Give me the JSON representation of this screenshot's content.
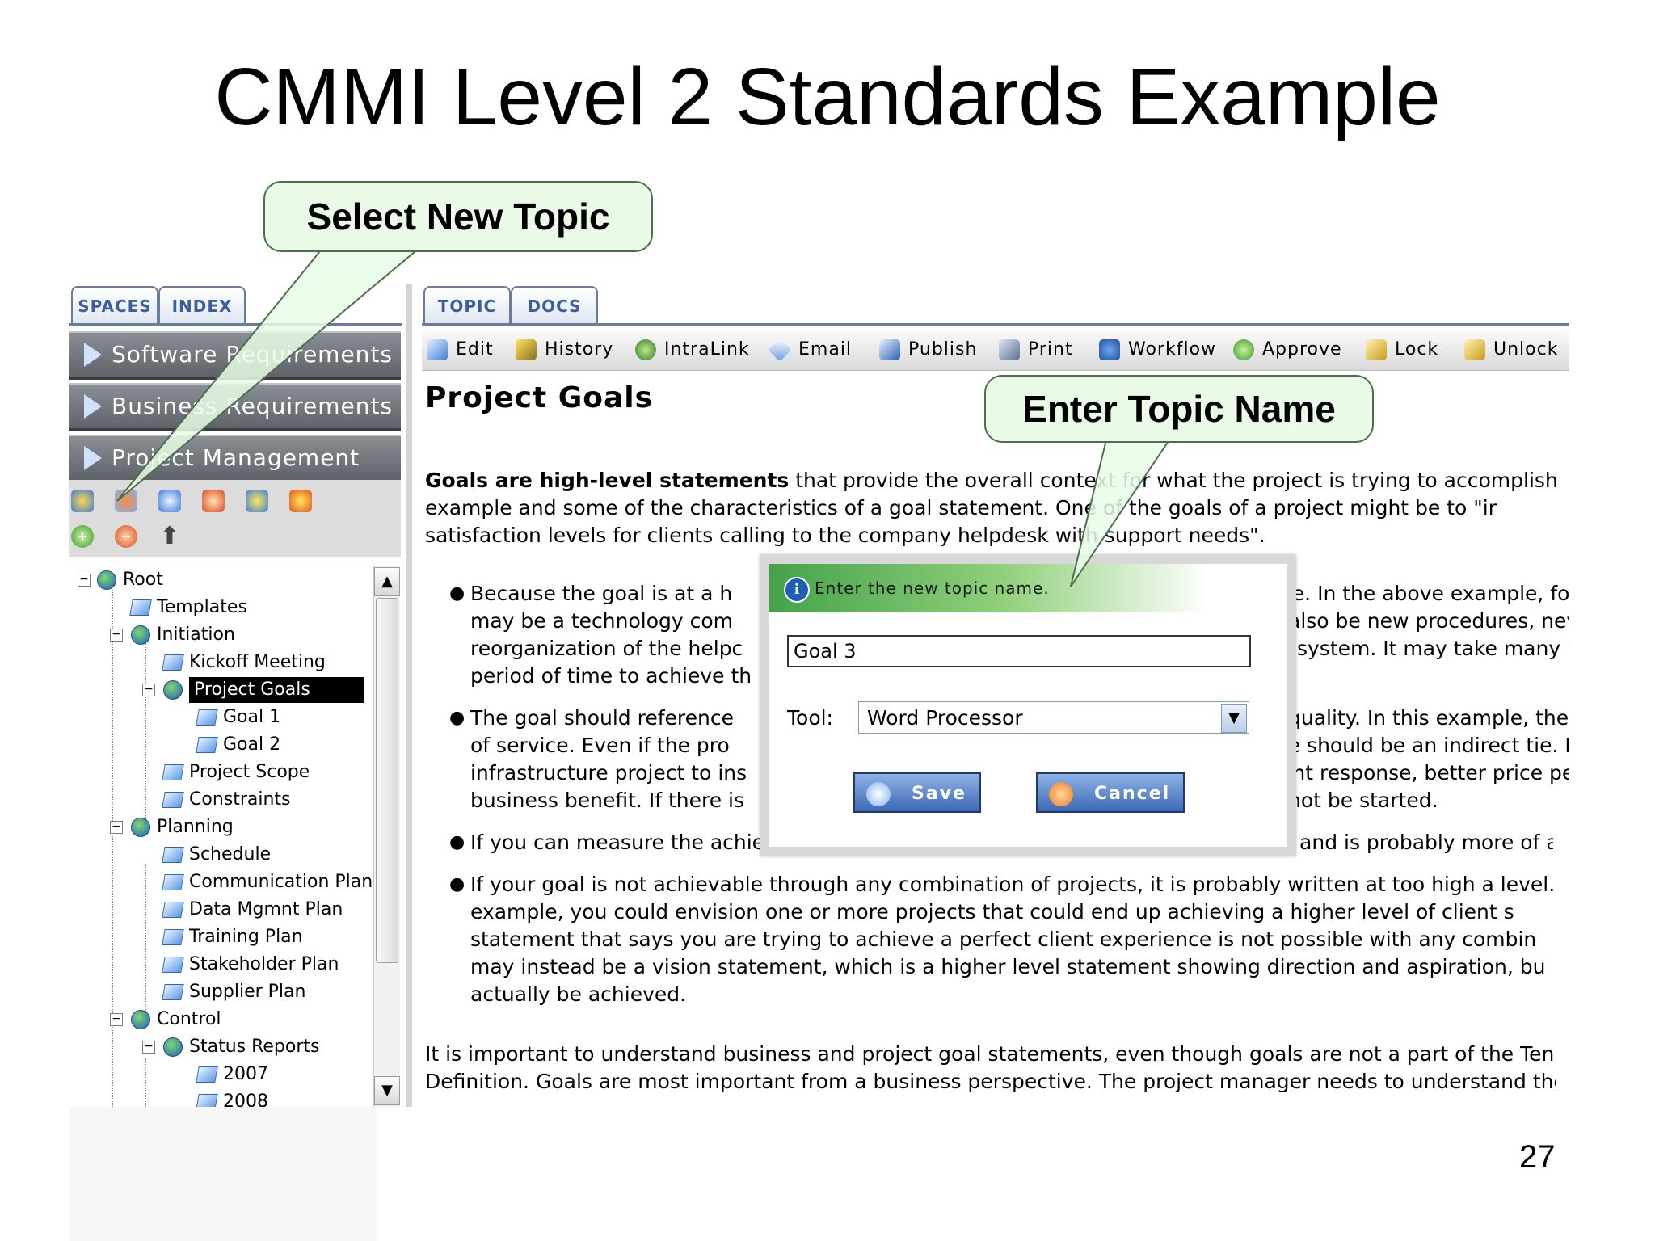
{
  "slide": {
    "title": "CMMI Level 2 Standards Example",
    "page_number": "27"
  },
  "callouts": {
    "select_topic": "Select New Topic",
    "enter_name": "Enter Topic Name"
  },
  "left_panel": {
    "tabs": [
      "SPACES",
      "INDEX"
    ],
    "spaces": [
      "Software Requirements",
      "Business Requirements",
      "Project Management"
    ],
    "tree": [
      {
        "label": "Root",
        "icon": "globe-icon",
        "expanded": true
      },
      {
        "label": "Templates",
        "icon": "gem-icon"
      },
      {
        "label": "Initiation",
        "icon": "globe-icon",
        "expanded": true
      },
      {
        "label": "Kickoff Meeting",
        "icon": "gem-icon"
      },
      {
        "label": "Project Goals",
        "icon": "globe-icon",
        "expanded": true,
        "selected": true
      },
      {
        "label": "Goal 1",
        "icon": "gem-icon"
      },
      {
        "label": "Goal 2",
        "icon": "gem-icon"
      },
      {
        "label": "Project Scope",
        "icon": "gem-icon"
      },
      {
        "label": "Constraints",
        "icon": "gem-icon"
      },
      {
        "label": "Planning",
        "icon": "globe-icon",
        "expanded": true
      },
      {
        "label": "Schedule",
        "icon": "gem-icon"
      },
      {
        "label": "Communication Plan",
        "icon": "gem-icon"
      },
      {
        "label": "Data Mgmnt Plan",
        "icon": "gem-icon"
      },
      {
        "label": "Training Plan",
        "icon": "gem-icon"
      },
      {
        "label": "Stakeholder Plan",
        "icon": "gem-icon"
      },
      {
        "label": "Supplier Plan",
        "icon": "gem-icon"
      },
      {
        "label": "Control",
        "icon": "globe-icon",
        "expanded": true
      },
      {
        "label": "Status Reports",
        "icon": "globe-icon",
        "expanded": true
      },
      {
        "label": "2007",
        "icon": "gem-icon"
      },
      {
        "label": "2008",
        "icon": "gem-icon"
      }
    ]
  },
  "right_panel": {
    "tabs": [
      "TOPIC",
      "DOCS"
    ],
    "toolbar": [
      "Edit",
      "History",
      "IntraLink",
      "Email",
      "Publish",
      "Print",
      "Workflow",
      "Approve",
      "Lock",
      "Unlock"
    ],
    "heading": "Project Goals",
    "intro": {
      "bold": "Goals are high-level statements",
      "line1_rest": " that provide the overall context for what the project is trying to accomplish. Let's",
      "line2": "example and some of the characteristics of a goal statement. One of the goals of a project might be to \"ir",
      "line3": "satisfaction levels for clients calling to the company helpdesk with support needs\"."
    },
    "bullets": [
      [
        "Because the goal is at a h",
        "may be a technology com",
        "reorganization of the helpc",
        "period of time to achieve th"
      ],
      [
        "The goal should reference",
        "of service. Even if the pro",
        "infrastructure project to ins",
        "business benefit. If there is"
      ],
      [
        "If you can measure the achievement of your goal, it is probably at too low a level and is probably more of an"
      ],
      [
        "If your goal is not achievable through any combination of projects, it is probably written at too high a level. In",
        "example, you could envision one or more projects that could end up achieving a higher level of client s",
        "statement that says you are trying to achieve a perfect client experience is not possible with any combin",
        "may instead be a vision statement, which is a higher level statement showing direction and aspiration, bu",
        "actually be achieved."
      ]
    ],
    "bullets_right": [
      [
        "ve. In the above example, for i",
        "also be new procedures, nev",
        "s system. It may take many p"
      ],
      [
        "quality. In this example, the",
        "re should be an indirect tie. F",
        "ent response, better price pe",
        "not be started."
      ]
    ],
    "closing": [
      "It is important to understand business and project goal statements, even though goals are not a part of the TenStep",
      "Definition. Goals are most important from a business perspective. The project manager needs to understand the bu"
    ]
  },
  "dialog": {
    "message": "Enter the new topic name.",
    "input_value": "Goal 3",
    "tool_label": "Tool:",
    "tool_value": "Word Processor",
    "save": "Save",
    "cancel": "Cancel"
  }
}
